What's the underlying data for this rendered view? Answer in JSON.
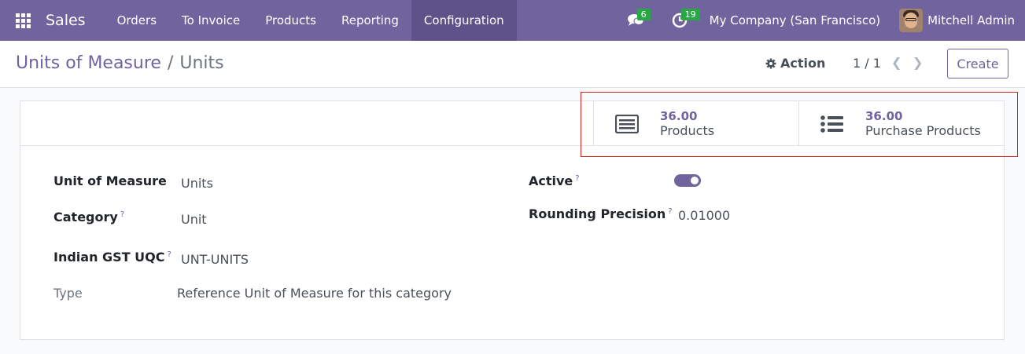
{
  "navbar": {
    "app_name": "Sales",
    "menu": [
      "Orders",
      "To Invoice",
      "Products",
      "Reporting",
      "Configuration"
    ],
    "active_menu": "Configuration",
    "messages_count": "6",
    "activities_count": "19",
    "company": "My Company (San Francisco)",
    "user": "Mitchell Admin",
    "accent_color": "#71639e"
  },
  "control": {
    "breadcrumb_parent": "Units of Measure",
    "breadcrumb_separator": "/",
    "breadcrumb_current": "Units",
    "action_label": "Action",
    "pager": "1 / 1",
    "create_label": "Create"
  },
  "smart_buttons": [
    {
      "value": "36.00",
      "label": "Products",
      "icon": "list-alt-icon"
    },
    {
      "value": "36.00",
      "label": "Purchase Products",
      "icon": "list-icon"
    }
  ],
  "fields": {
    "uom_label": "Unit of Measure",
    "uom_value": "Units",
    "category_label": "Category",
    "category_value": "Unit",
    "gst_label": "Indian GST UQC",
    "gst_value": "UNT-UNITS",
    "type_label": "Type",
    "type_value": "Reference Unit of Measure for this category",
    "active_label": "Active",
    "active_value": true,
    "rounding_label": "Rounding Precision",
    "rounding_value": "0.01000",
    "help_mark": "?"
  }
}
